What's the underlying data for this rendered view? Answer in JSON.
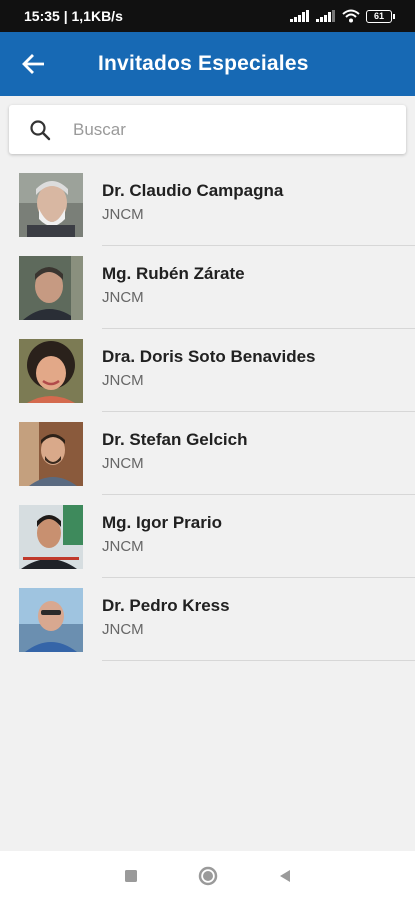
{
  "status_bar": {
    "time_speed": "15:35 | 1,1KB/s",
    "battery": "61"
  },
  "app_bar": {
    "title": "Invitados Especiales",
    "back_icon": "arrow-back-icon"
  },
  "search": {
    "placeholder": "Buscar",
    "value": ""
  },
  "guests": [
    {
      "name": "Dr. Claudio Campagna",
      "org": "JNCM"
    },
    {
      "name": "Mg. Rubén Zárate",
      "org": "JNCM"
    },
    {
      "name": "Dra. Doris Soto Benavides",
      "org": "JNCM"
    },
    {
      "name": "Dr. Stefan Gelcich",
      "org": "JNCM"
    },
    {
      "name": "Mg. Igor Prario",
      "org": "JNCM"
    },
    {
      "name": "Dr. Pedro Kress",
      "org": "JNCM"
    }
  ],
  "nav": {
    "recents_icon": "square-icon",
    "home_icon": "circle-icon",
    "back_icon": "triangle-back-icon"
  },
  "colors": {
    "app_bar": "#1769b4",
    "status_bar": "#111111",
    "background": "#f1f1f1"
  }
}
